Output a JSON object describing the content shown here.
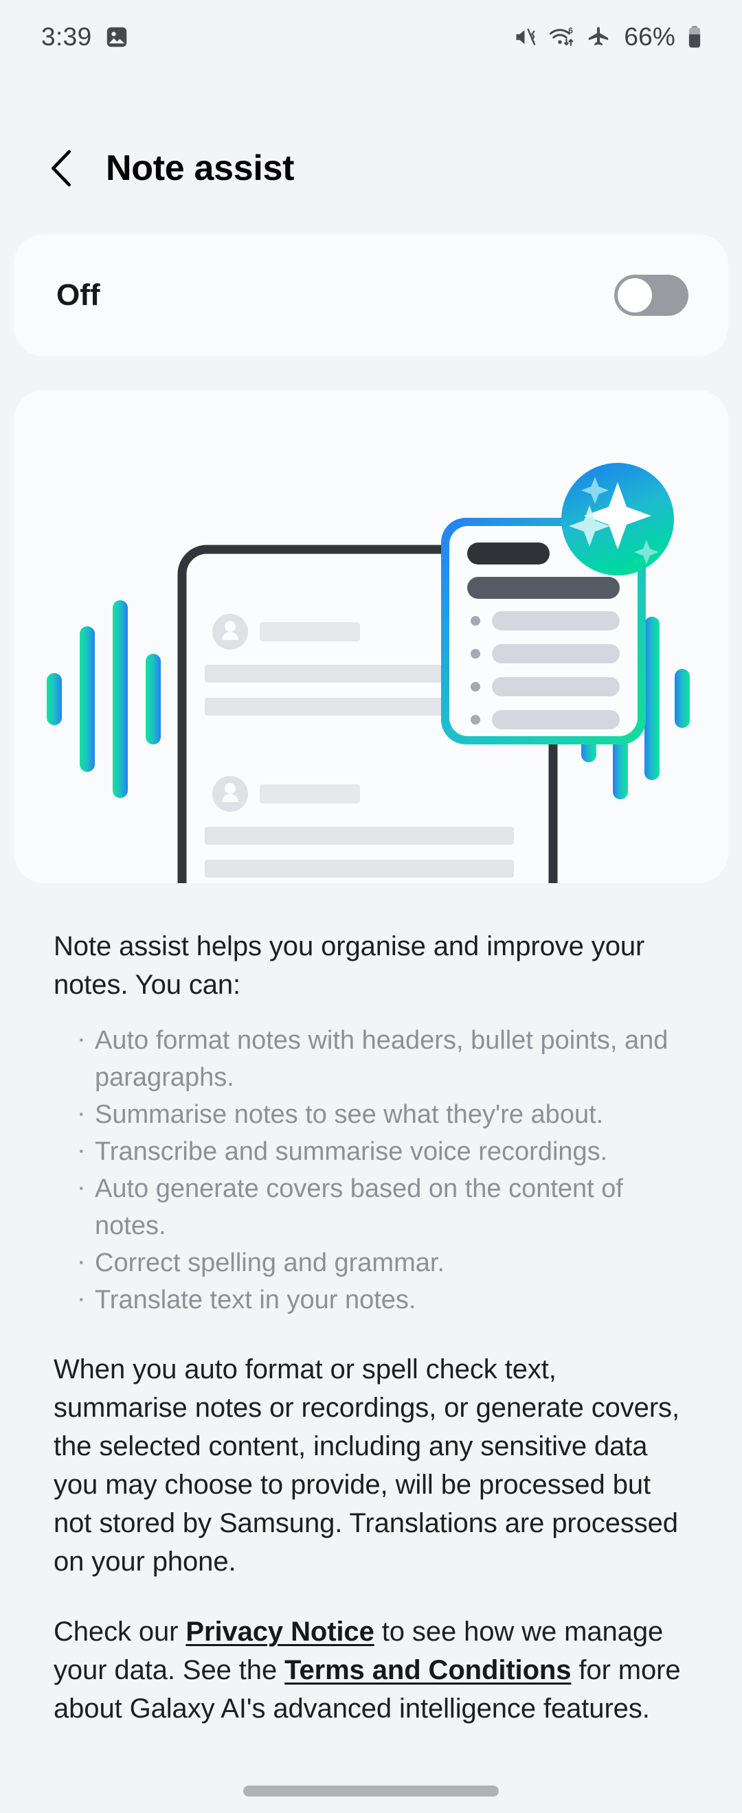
{
  "status_bar": {
    "time": "3:39",
    "battery_percent": "66%",
    "icons": [
      "gallery-image-icon",
      "mute-vibrate-icon",
      "wifi-6-data-icon",
      "airplane-mode-icon",
      "battery-icon"
    ]
  },
  "header": {
    "back_label": "Back",
    "title": "Note assist"
  },
  "toggle_card": {
    "state_label": "Off",
    "enabled": false
  },
  "illustration": {
    "alt": "Phone showing notes with an AI summary card and voice waveforms",
    "badge": "ai-sparkle-badge",
    "gradient_start": "#1a7ef0",
    "gradient_end": "#00d9a0",
    "wave_color_left": "#1ce8a0",
    "wave_color_right": "#2680f5",
    "phone_outline": "#333538",
    "placeholder_line": "#e2e4e8",
    "card_title_bar": "#2f3237",
    "card_subtitle_bar": "#555b63",
    "card_bullet_pill": "#d4d7dd"
  },
  "description": {
    "intro": "Note assist helps you organise and improve your notes. You can:",
    "capabilities": [
      "Auto format notes with headers, bullet points, and paragraphs.",
      "Summarise notes to see what they're about.",
      "Transcribe and summarise voice recordings.",
      "Auto generate covers based on the content of notes.",
      "Correct spelling and grammar.",
      "Translate text in your notes."
    ],
    "privacy": "When you auto format or spell check text, summarise notes or recordings, or generate covers, the selected content, including any sensitive data you may choose to provide, will be processed but not stored by Samsung. Translations are processed on your phone.",
    "links_paragraph": {
      "part1": "Check our ",
      "link1": "Privacy Notice",
      "part2": " to see how we manage your data. See the ",
      "link2": "Terms and Conditions",
      "part3": " for more about Galaxy AI's advanced intelligence features."
    }
  },
  "navigation": {
    "home_indicator": "home-gesture-bar"
  },
  "colors": {
    "page_background": "#f3f4f6",
    "card_background": "#fafbfc",
    "text_primary": "#1d1e20",
    "text_secondary": "#8e9096",
    "switch_off": "#9a9ba1"
  }
}
